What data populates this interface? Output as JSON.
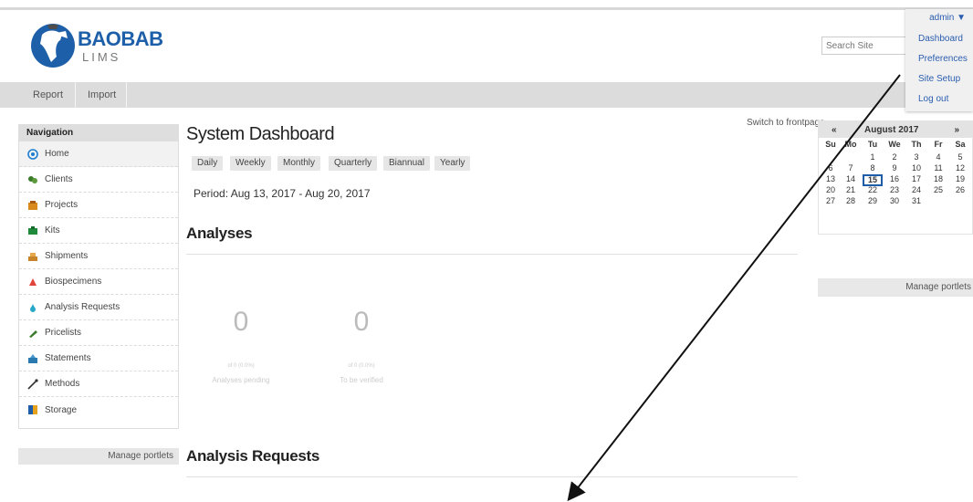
{
  "header": {
    "logo_text": "BAOBAB",
    "logo_sub": "LIMS",
    "search_placeholder": "Search Site"
  },
  "user_menu": {
    "username": "admin ▼",
    "items": [
      "Dashboard",
      "Preferences",
      "Site Setup",
      "Log out"
    ]
  },
  "top_nav": {
    "tabs": [
      "Report",
      "Import"
    ]
  },
  "sidebar": {
    "heading": "Navigation",
    "items": [
      {
        "label": "Home",
        "icon": "home-icon"
      },
      {
        "label": "Clients",
        "icon": "clients-icon"
      },
      {
        "label": "Projects",
        "icon": "projects-icon"
      },
      {
        "label": "Kits",
        "icon": "kits-icon"
      },
      {
        "label": "Shipments",
        "icon": "shipments-icon"
      },
      {
        "label": "Biospecimens",
        "icon": "biospecimens-icon"
      },
      {
        "label": "Analysis Requests",
        "icon": "analysis-requests-icon"
      },
      {
        "label": "Pricelists",
        "icon": "pricelists-icon"
      },
      {
        "label": "Statements",
        "icon": "statements-icon"
      },
      {
        "label": "Methods",
        "icon": "methods-icon"
      },
      {
        "label": "Storage",
        "icon": "storage-icon"
      }
    ],
    "manage_portlets": "Manage portlets"
  },
  "main": {
    "switch_link": "Switch to frontpage",
    "title": "System Dashboard",
    "period_tabs": [
      "Daily",
      "Weekly",
      "Monthly",
      "Quarterly",
      "Biannual",
      "Yearly"
    ],
    "period_text": "Period:  Aug 13, 2017 -  Aug 20, 2017",
    "analyses_title": "Analyses",
    "stats": [
      {
        "value": "0",
        "sub": "of 0 (0.0%)",
        "label": "Analyses pending"
      },
      {
        "value": "0",
        "sub": "of 0 (0.0%)",
        "label": "To be verified"
      }
    ],
    "analysis_requests_title": "Analysis Requests"
  },
  "calendar": {
    "prev": "«",
    "next": "»",
    "title": "August 2017",
    "days_of_week": [
      "Su",
      "Mo",
      "Tu",
      "We",
      "Th",
      "Fr",
      "Sa"
    ],
    "weeks": [
      [
        "",
        "",
        "1",
        "2",
        "3",
        "4",
        "5"
      ],
      [
        "6",
        "7",
        "8",
        "9",
        "10",
        "11",
        "12"
      ],
      [
        "13",
        "14",
        "15",
        "16",
        "17",
        "18",
        "19"
      ],
      [
        "20",
        "21",
        "22",
        "23",
        "24",
        "25",
        "26"
      ],
      [
        "27",
        "28",
        "29",
        "30",
        "31",
        "",
        ""
      ]
    ],
    "today": "15",
    "manage_portlets": "Manage portlets"
  },
  "colors": {
    "brand": "#1d5fa8",
    "link": "#2a5db0",
    "nav_bg": "#dcdcdc"
  }
}
